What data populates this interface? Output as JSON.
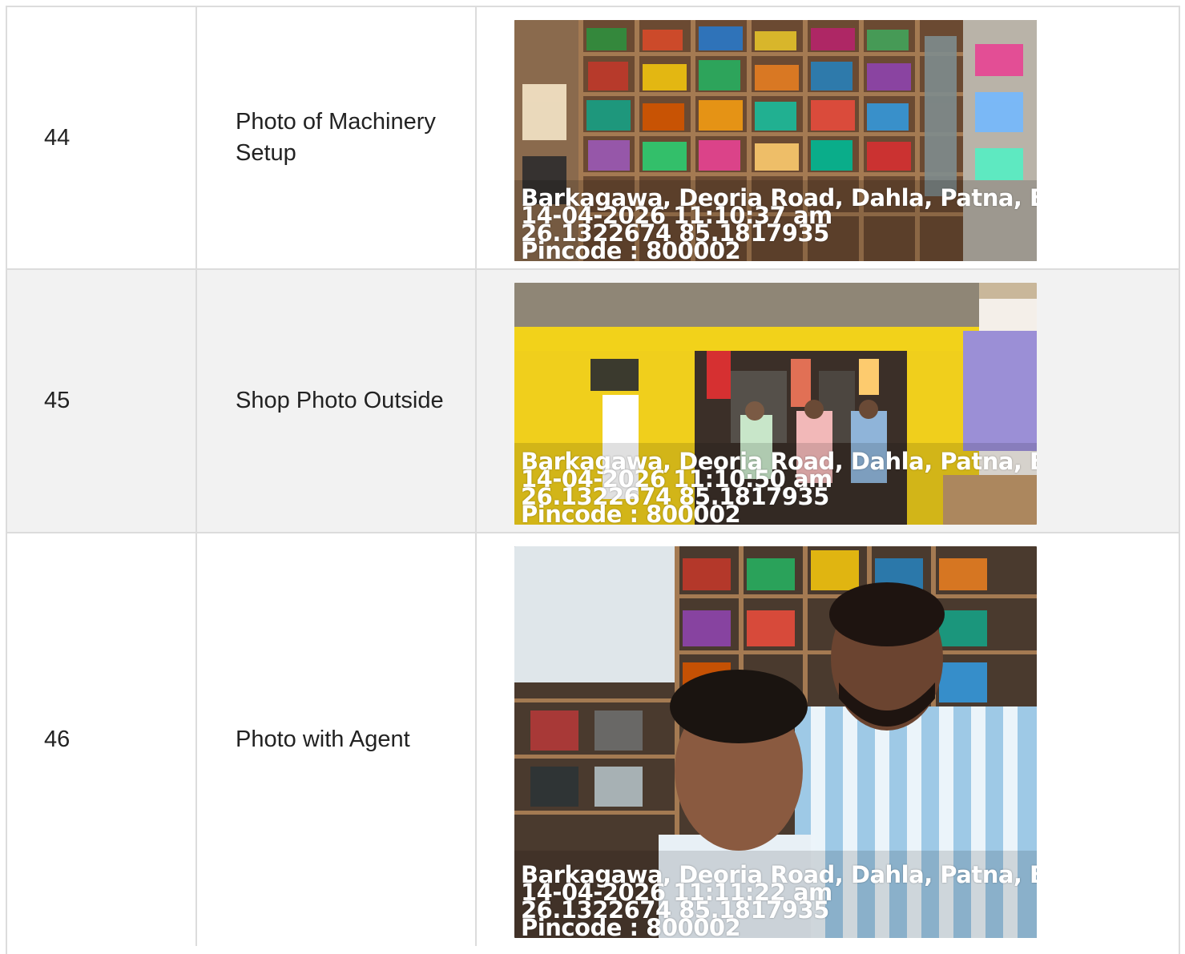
{
  "rows": [
    {
      "number": "44",
      "label": "Photo of Machinery Setup",
      "photo": {
        "icon": "shop-shelves-photo",
        "address": "Barkagawa, Deoria Road, Dahla, Patna, Bihar",
        "datetime": "14-04-2026 11:10:37 am",
        "coords": "26.1322674 85.1817935",
        "pincode": "Pincode : 800002"
      }
    },
    {
      "number": "45",
      "label": "Shop Photo Outside",
      "photo": {
        "icon": "shop-exterior-photo",
        "address": "Barkagawa, Deoria Road, Dahla, Patna, Bihar",
        "datetime": "14-04-2026 11:10:50 am",
        "coords": "26.1322674 85.1817935",
        "pincode": "Pincode : 800002"
      }
    },
    {
      "number": "46",
      "label": "Photo with Agent",
      "photo": {
        "icon": "agent-selfie-photo",
        "address": "Barkagawa, Deoria Road, Dahla, Patna, Bihar",
        "datetime": "14-04-2026 11:11:22 am",
        "coords": "26.1322674 85.1817935",
        "pincode": "Pincode : 800002"
      }
    }
  ],
  "colors": {
    "border": "#dcdcdc",
    "shaded_row": "#f2f2f2",
    "text": "#222222",
    "overlay_text": "#ffffff",
    "shop_wall_yellow": "#f2d21a"
  }
}
